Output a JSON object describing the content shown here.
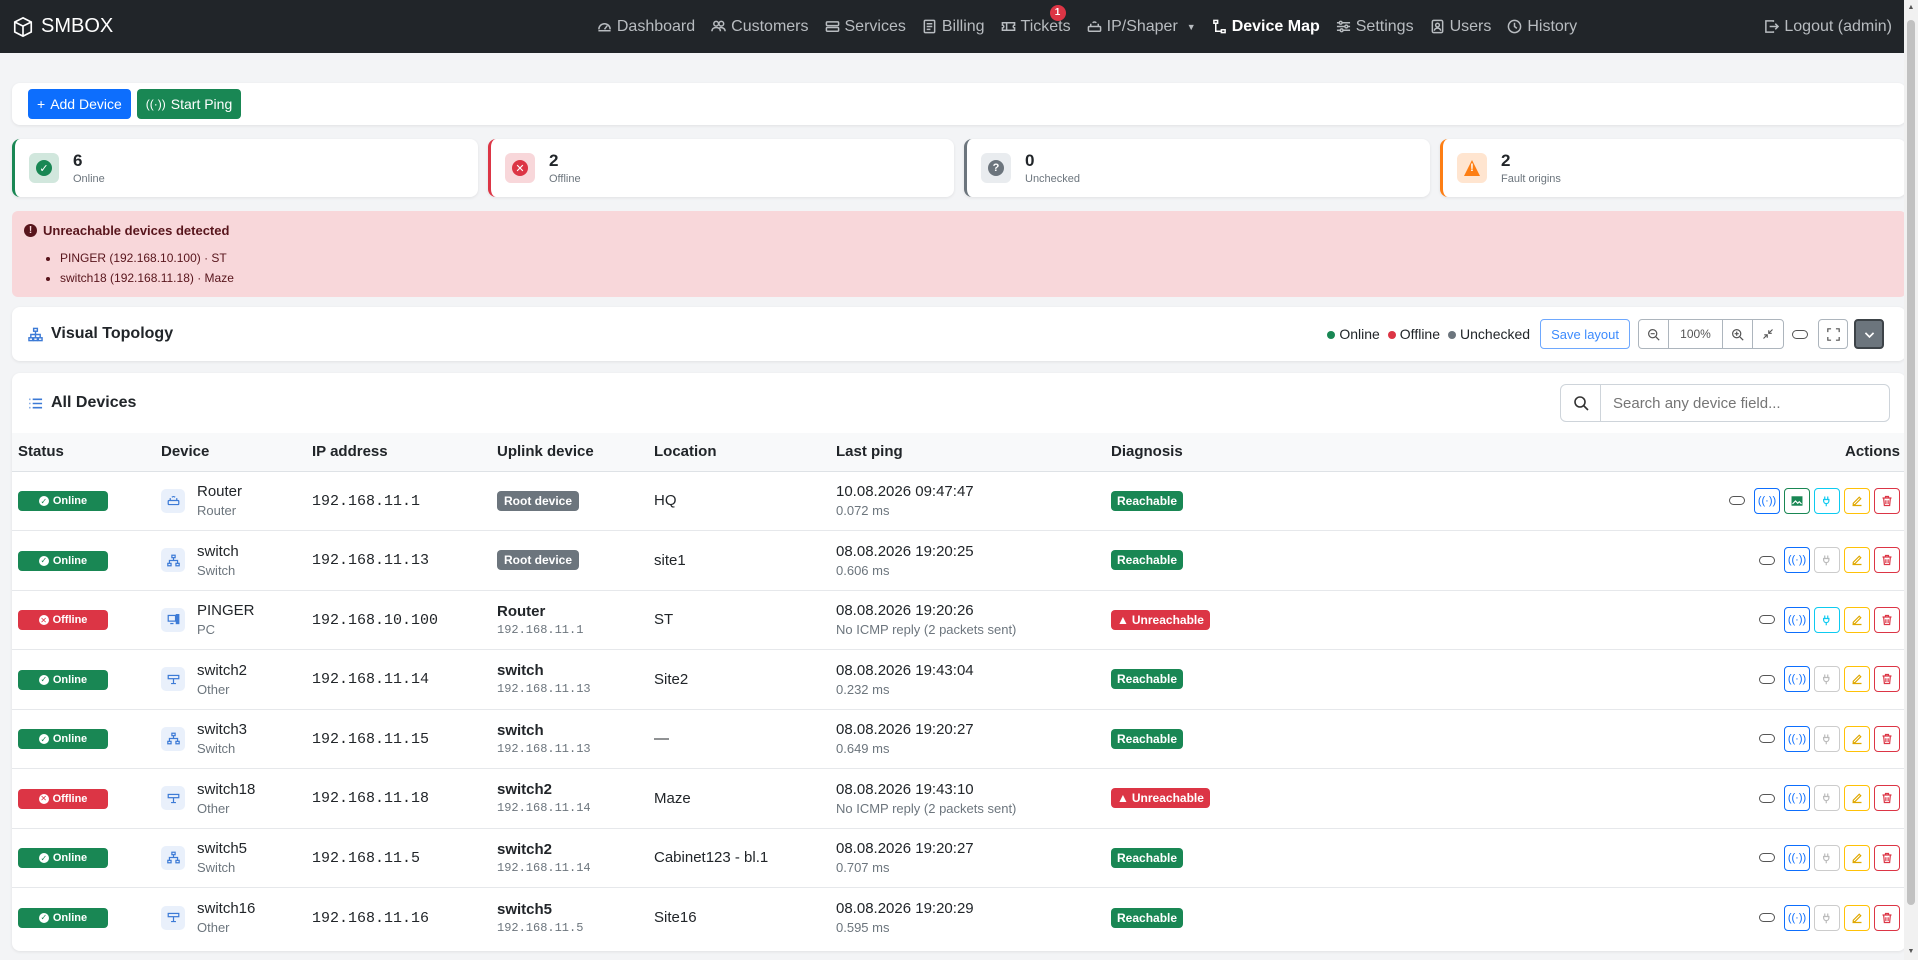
{
  "brand": {
    "name": "SMBOX"
  },
  "nav": {
    "items": [
      {
        "label": "Dashboard",
        "icon": "dashboard-icon"
      },
      {
        "label": "Customers",
        "icon": "people-icon"
      },
      {
        "label": "Services",
        "icon": "services-icon"
      },
      {
        "label": "Billing",
        "icon": "billing-icon"
      },
      {
        "label": "Tickets",
        "icon": "ticket-icon",
        "badge": "1"
      },
      {
        "label": "IP/Shaper",
        "icon": "router-icon"
      },
      {
        "label": "Device Map",
        "icon": "diagram-icon",
        "active": true
      },
      {
        "label": "Settings",
        "icon": "sliders-icon"
      },
      {
        "label": "Users",
        "icon": "user-icon"
      },
      {
        "label": "History",
        "icon": "clock-icon"
      }
    ],
    "logout": "Logout (admin)"
  },
  "toolbar": {
    "add_device": "Add Device",
    "start_ping": "Start Ping"
  },
  "stats": [
    {
      "value": "6",
      "label": "Online",
      "color": "#198754",
      "bg": "#d1e7dd",
      "glyph": "✓"
    },
    {
      "value": "2",
      "label": "Offline",
      "color": "#dc3545",
      "bg": "#f8d7da",
      "glyph": "✕"
    },
    {
      "value": "0",
      "label": "Unchecked",
      "color": "#6c757d",
      "bg": "#e9ecef",
      "glyph": "?"
    },
    {
      "value": "2",
      "label": "Fault origins",
      "color": "#fd7e14",
      "bg": "#ffe5d0",
      "glyph": "!"
    }
  ],
  "alert": {
    "title": "Unreachable devices detected",
    "items": [
      "PINGER (192.168.10.100) · ST",
      "switch18 (192.168.11.18) · Maze"
    ]
  },
  "topology": {
    "title": "Visual Topology",
    "legend": {
      "online": "Online",
      "offline": "Offline",
      "unchecked": "Unchecked"
    },
    "save_layout": "Save layout",
    "zoom": "100%"
  },
  "devices": {
    "title": "All Devices",
    "search_placeholder": "Search any device field...",
    "columns": [
      "Status",
      "Device",
      "IP address",
      "Uplink device",
      "Location",
      "Last ping",
      "Diagnosis",
      "Actions"
    ],
    "rows": [
      {
        "status": "Online",
        "name": "Router",
        "type": "Router",
        "icon": "router-icon",
        "ip": "192.168.11.1",
        "uplink_root": "Root device",
        "uplink_name": "",
        "uplink_ip": "",
        "location": "HQ",
        "last_ping": "10.08.2026 09:47:47",
        "ping_detail": "0.072 ms",
        "diagnosis": "Reachable",
        "link_enabled": true,
        "has_view": true
      },
      {
        "status": "Online",
        "name": "switch",
        "type": "Switch",
        "icon": "switch-icon",
        "ip": "192.168.11.13",
        "uplink_root": "Root device",
        "uplink_name": "",
        "uplink_ip": "",
        "location": "site1",
        "last_ping": "08.08.2026 19:20:25",
        "ping_detail": "0.606 ms",
        "diagnosis": "Reachable",
        "link_enabled": false,
        "has_view": false
      },
      {
        "status": "Offline",
        "name": "PINGER",
        "type": "PC",
        "icon": "pc-icon",
        "ip": "192.168.10.100",
        "uplink_root": "",
        "uplink_name": "Router",
        "uplink_ip": "192.168.11.1",
        "location": "ST",
        "last_ping": "08.08.2026 19:20:26",
        "ping_detail": "No ICMP reply (2 packets sent)",
        "diagnosis": "Unreachable",
        "link_enabled": true,
        "has_view": false
      },
      {
        "status": "Online",
        "name": "switch2",
        "type": "Other",
        "icon": "other-icon",
        "ip": "192.168.11.14",
        "uplink_root": "",
        "uplink_name": "switch",
        "uplink_ip": "192.168.11.13",
        "location": "Site2",
        "last_ping": "08.08.2026 19:43:04",
        "ping_detail": "0.232 ms",
        "diagnosis": "Reachable",
        "link_enabled": false,
        "has_view": false
      },
      {
        "status": "Online",
        "name": "switch3",
        "type": "Switch",
        "icon": "switch-icon",
        "ip": "192.168.11.15",
        "uplink_root": "",
        "uplink_name": "switch",
        "uplink_ip": "192.168.11.13",
        "location": "—",
        "last_ping": "08.08.2026 19:20:27",
        "ping_detail": "0.649 ms",
        "diagnosis": "Reachable",
        "link_enabled": false,
        "has_view": false
      },
      {
        "status": "Offline",
        "name": "switch18",
        "type": "Other",
        "icon": "other-icon",
        "ip": "192.168.11.18",
        "uplink_root": "",
        "uplink_name": "switch2",
        "uplink_ip": "192.168.11.14",
        "location": "Maze",
        "last_ping": "08.08.2026 19:43:10",
        "ping_detail": "No ICMP reply (2 packets sent)",
        "diagnosis": "Unreachable",
        "link_enabled": false,
        "has_view": false
      },
      {
        "status": "Online",
        "name": "switch5",
        "type": "Switch",
        "icon": "switch-icon",
        "ip": "192.168.11.5",
        "uplink_root": "",
        "uplink_name": "switch2",
        "uplink_ip": "192.168.11.14",
        "location": "Cabinet123 - bl.1",
        "last_ping": "08.08.2026 19:20:27",
        "ping_detail": "0.707 ms",
        "diagnosis": "Reachable",
        "link_enabled": false,
        "has_view": false
      },
      {
        "status": "Online",
        "name": "switch16",
        "type": "Other",
        "icon": "other-icon",
        "ip": "192.168.11.16",
        "uplink_root": "",
        "uplink_name": "switch5",
        "uplink_ip": "192.168.11.5",
        "location": "Site16",
        "last_ping": "08.08.2026 19:20:29",
        "ping_detail": "0.595 ms",
        "diagnosis": "Reachable",
        "link_enabled": false,
        "has_view": false
      }
    ]
  }
}
